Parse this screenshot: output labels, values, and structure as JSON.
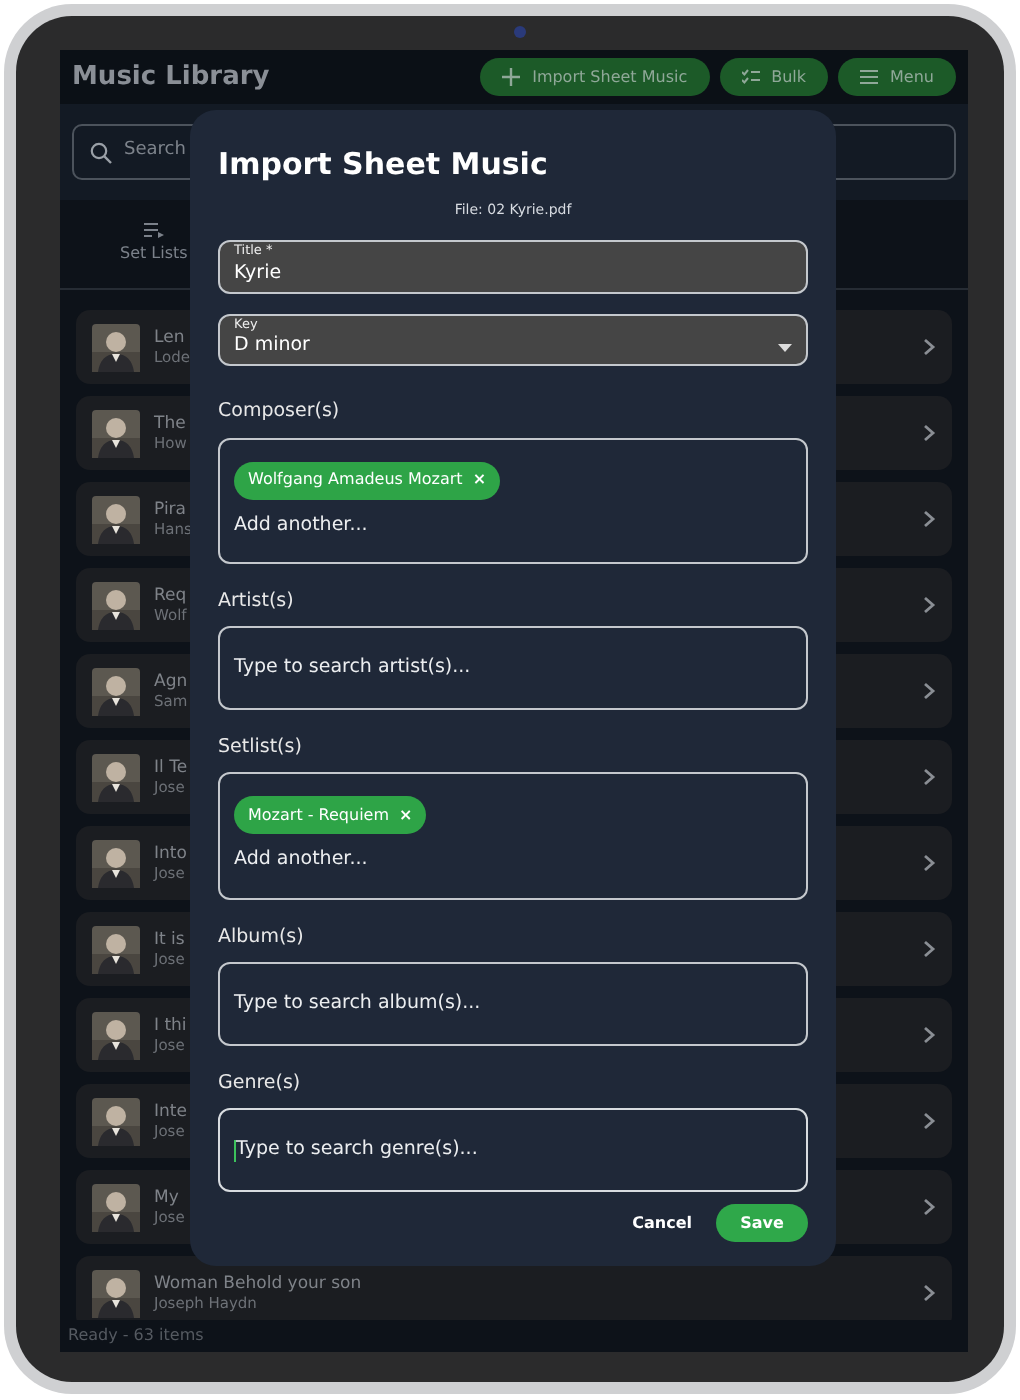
{
  "app": {
    "title": "Music Library",
    "header_buttons": [
      {
        "label": "Import Sheet Music"
      },
      {
        "label": "Bulk"
      },
      {
        "label": "Menu"
      }
    ]
  },
  "search": {
    "placeholder": "Search"
  },
  "tabs": [
    {
      "label": "Set Lists",
      "selected": false
    }
  ],
  "items": [
    {
      "title": "Len",
      "subtitle": "Lode"
    },
    {
      "title": "The",
      "subtitle": "How"
    },
    {
      "title": "Pira",
      "subtitle": "Hans"
    },
    {
      "title": "Req",
      "subtitle": "Wolf"
    },
    {
      "title": "Agn",
      "subtitle": "Sam"
    },
    {
      "title": "Il Te",
      "subtitle": "Jose"
    },
    {
      "title": "Into",
      "subtitle": "Jose"
    },
    {
      "title": "It is",
      "subtitle": "Jose"
    },
    {
      "title": "I thi",
      "subtitle": "Jose"
    },
    {
      "title": "Inte",
      "subtitle": "Jose"
    },
    {
      "title": "My",
      "subtitle": "Jose"
    },
    {
      "title": "Woman Behold your son",
      "subtitle": "Joseph Haydn"
    }
  ],
  "status_bar": "Ready - 63 items",
  "dialog": {
    "title": "Import Sheet Music",
    "file": "File: 02 Kyrie.pdf",
    "fields": [
      {
        "kind": "text",
        "label": "Title *",
        "value": "Kyrie",
        "focused": false
      },
      {
        "kind": "select",
        "label": "Key",
        "value": "D minor",
        "focused": false
      },
      {
        "kind": "tags",
        "label": "Composer(s)",
        "tags": [
          {
            "label": "Wolfgang Amadeus Mozart",
            "remove": "×"
          }
        ],
        "placeholder": "Add another...",
        "focused": false
      },
      {
        "kind": "search",
        "label": "Artist(s)",
        "placeholder": "Type to search artist(s)...",
        "focused": false
      },
      {
        "kind": "tags",
        "label": "Setlist(s)",
        "tags": [
          {
            "label": "Mozart - Requiem",
            "remove": "×"
          }
        ],
        "placeholder": "Add another...",
        "focused": false
      },
      {
        "kind": "search",
        "label": "Album(s)",
        "placeholder": "Type to search album(s)...",
        "focused": false
      },
      {
        "kind": "search",
        "label": "Genre(s)",
        "placeholder": "Type to search genre(s)...",
        "focused": true
      }
    ],
    "buttons": [
      {
        "kind": "text",
        "label": "Cancel"
      },
      {
        "kind": "primary",
        "label": "Save"
      }
    ]
  }
}
